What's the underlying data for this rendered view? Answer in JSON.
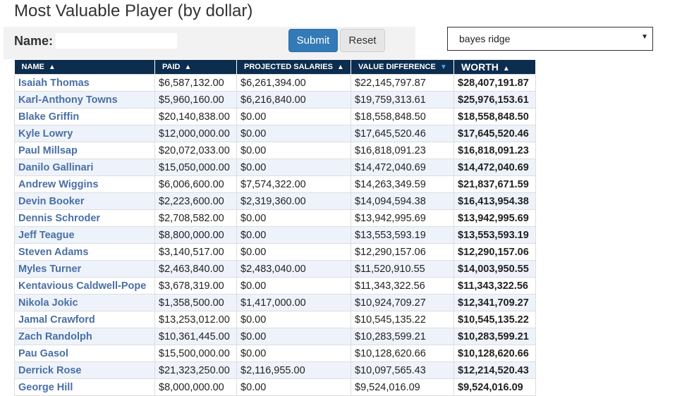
{
  "title": "Most Valuable Player (by dollar)",
  "form": {
    "name_label": "Name:",
    "name_value": "",
    "name_placeholder": "",
    "submit_label": "Submit",
    "reset_label": "Reset"
  },
  "model_select": {
    "selected": "bayes ridge"
  },
  "table": {
    "columns": [
      {
        "label": "NAME",
        "sort": "asc"
      },
      {
        "label": "PAID",
        "sort": "asc"
      },
      {
        "label": "PROJECTED SALARIES",
        "sort": "asc"
      },
      {
        "label": "VALUE DIFFERENCE",
        "sort": "desc"
      },
      {
        "label": "WORTH",
        "sort": "asc"
      }
    ],
    "rows": [
      {
        "name": "Isaiah Thomas",
        "paid": "$6,587,132.00",
        "projected": "$6,261,394.00",
        "diff": "$22,145,797.87",
        "worth": "$28,407,191.87"
      },
      {
        "name": "Karl-Anthony Towns",
        "paid": "$5,960,160.00",
        "projected": "$6,216,840.00",
        "diff": "$19,759,313.61",
        "worth": "$25,976,153.61"
      },
      {
        "name": "Blake Griffin",
        "paid": "$20,140,838.00",
        "projected": "$0.00",
        "diff": "$18,558,848.50",
        "worth": "$18,558,848.50"
      },
      {
        "name": "Kyle Lowry",
        "paid": "$12,000,000.00",
        "projected": "$0.00",
        "diff": "$17,645,520.46",
        "worth": "$17,645,520.46"
      },
      {
        "name": "Paul Millsap",
        "paid": "$20,072,033.00",
        "projected": "$0.00",
        "diff": "$16,818,091.23",
        "worth": "$16,818,091.23"
      },
      {
        "name": "Danilo Gallinari",
        "paid": "$15,050,000.00",
        "projected": "$0.00",
        "diff": "$14,472,040.69",
        "worth": "$14,472,040.69"
      },
      {
        "name": "Andrew Wiggins",
        "paid": "$6,006,600.00",
        "projected": "$7,574,322.00",
        "diff": "$14,263,349.59",
        "worth": "$21,837,671.59"
      },
      {
        "name": "Devin Booker",
        "paid": "$2,223,600.00",
        "projected": "$2,319,360.00",
        "diff": "$14,094,594.38",
        "worth": "$16,413,954.38"
      },
      {
        "name": "Dennis Schroder",
        "paid": "$2,708,582.00",
        "projected": "$0.00",
        "diff": "$13,942,995.69",
        "worth": "$13,942,995.69"
      },
      {
        "name": "Jeff Teague",
        "paid": "$8,800,000.00",
        "projected": "$0.00",
        "diff": "$13,553,593.19",
        "worth": "$13,553,593.19"
      },
      {
        "name": "Steven Adams",
        "paid": "$3,140,517.00",
        "projected": "$0.00",
        "diff": "$12,290,157.06",
        "worth": "$12,290,157.06"
      },
      {
        "name": "Myles Turner",
        "paid": "$2,463,840.00",
        "projected": "$2,483,040.00",
        "diff": "$11,520,910.55",
        "worth": "$14,003,950.55"
      },
      {
        "name": "Kentavious Caldwell-Pope",
        "paid": "$3,678,319.00",
        "projected": "$0.00",
        "diff": "$11,343,322.56",
        "worth": "$11,343,322.56"
      },
      {
        "name": "Nikola Jokic",
        "paid": "$1,358,500.00",
        "projected": "$1,417,000.00",
        "diff": "$10,924,709.27",
        "worth": "$12,341,709.27"
      },
      {
        "name": "Jamal Crawford",
        "paid": "$13,253,012.00",
        "projected": "$0.00",
        "diff": "$10,545,135.22",
        "worth": "$10,545,135.22"
      },
      {
        "name": "Zach Randolph",
        "paid": "$10,361,445.00",
        "projected": "$0.00",
        "diff": "$10,283,599.21",
        "worth": "$10,283,599.21"
      },
      {
        "name": "Pau Gasol",
        "paid": "$15,500,000.00",
        "projected": "$0.00",
        "diff": "$10,128,620.66",
        "worth": "$10,128,620.66"
      },
      {
        "name": "Derrick Rose",
        "paid": "$21,323,250.00",
        "projected": "$2,116,955.00",
        "diff": "$10,097,565.43",
        "worth": "$12,214,520.43"
      },
      {
        "name": "George Hill",
        "paid": "$8,000,000.00",
        "projected": "$0.00",
        "diff": "$9,524,016.09",
        "worth": "$9,524,016.09"
      }
    ]
  },
  "colors": {
    "header_bg": "#0c2d4e",
    "accent_blue": "#337ab7",
    "player_link": "#4a6fa5",
    "stripe": "#eef3fb"
  }
}
